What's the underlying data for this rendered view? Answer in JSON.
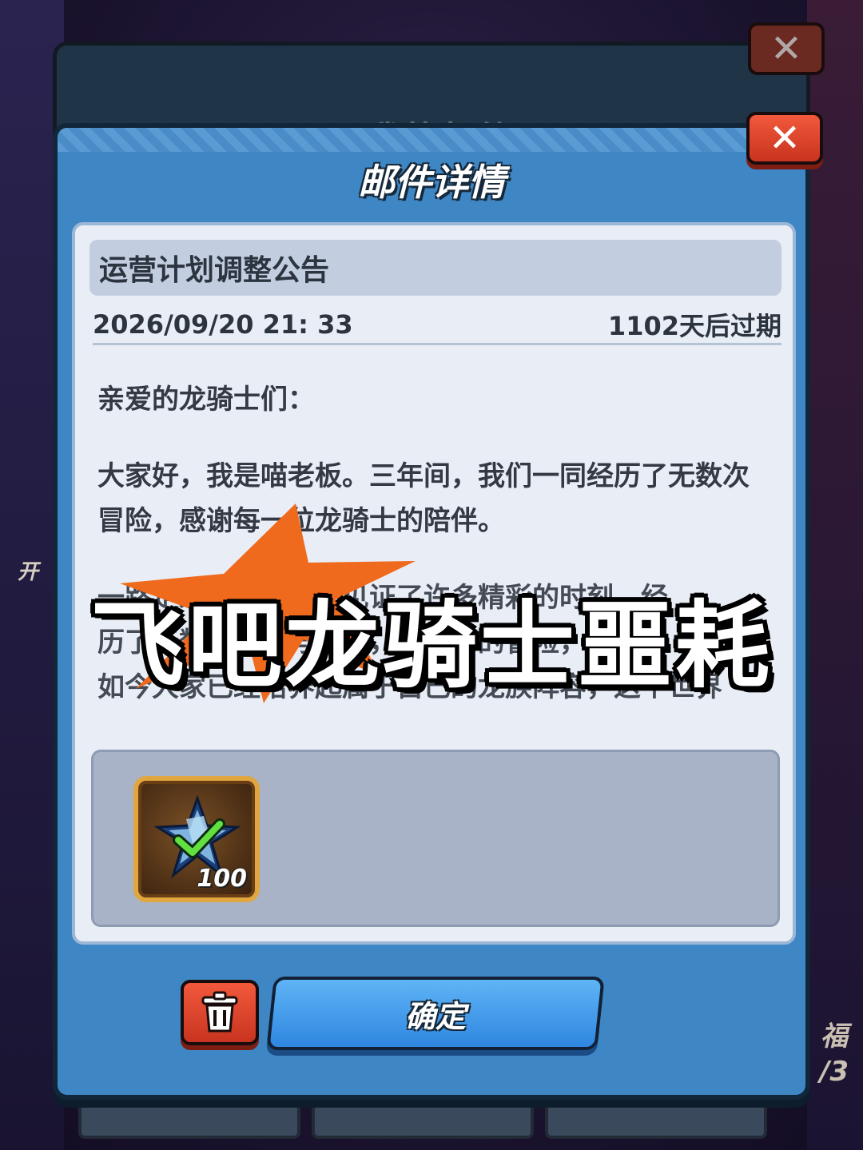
{
  "background": {
    "left_label": "开",
    "right_label_top": "福",
    "right_label_bottom": "/3"
  },
  "mail_list": {
    "title": "我的邮件",
    "close_icon": "close-icon"
  },
  "detail": {
    "title": "邮件详情",
    "close_icon": "close-icon",
    "subject": "运营计划调整公告",
    "date": "2026/09/20 21: 33",
    "expiry": "1102天后过期",
    "body": {
      "greeting": "亲爱的龙骑士们：",
      "paragraph1": "大家好，我是喵老板。三年间，我们一同经历了无数次冒险，感谢每一位龙骑士的陪伴。",
      "paragraph2_partial_line1": "一路走来，我们一同见证了许多精彩的时刻，经",
      "paragraph2_partial_line2": "历了无数次挑战与成长，从最初的冒险，直到",
      "paragraph2_partial_line3": "如今大家已经培养起属于自己的龙族阵容，这个世界"
    },
    "reward": {
      "icon": "blue-crystal-checkmark-icon",
      "count": "100"
    },
    "delete_icon": "trash-icon",
    "confirm_label": "确定"
  },
  "overlay": {
    "caption": "飞吧龙骑士噩耗"
  },
  "colors": {
    "dialog_blue": "#3f86c4",
    "confirm_blue": "#3a95ea",
    "delete_red": "#e04a30",
    "burst_orange": "#f06a1e"
  }
}
